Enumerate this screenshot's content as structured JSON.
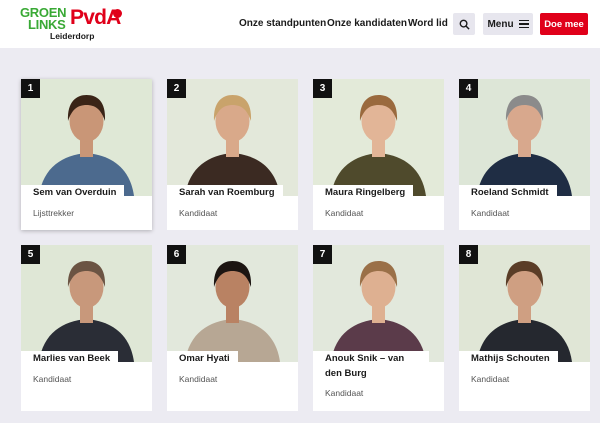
{
  "brand": {
    "line1": "GROEN",
    "line2": "LINKS",
    "party": "PvdA",
    "local": "Leiderdorp"
  },
  "nav": {
    "items": [
      "Onze standpunten",
      "Onze kandidaten",
      "Word lid"
    ],
    "menu_label": "Menu",
    "cta_label": "Doe mee"
  },
  "candidates": [
    {
      "number": "1",
      "name": "Sem van Overduin",
      "role": "Lijsttrekker",
      "bg": "#dfe8d6",
      "hair": "#3a2417",
      "skin": "#c99677",
      "clothes": "#4c6a8e"
    },
    {
      "number": "2",
      "name": "Sarah van Roemburg",
      "role": "Kandidaat",
      "bg": "#e3e8da",
      "hair": "#c9a36b",
      "skin": "#d9a98a",
      "clothes": "#3b2a22"
    },
    {
      "number": "3",
      "name": "Maura Ringelberg",
      "role": "Kandidaat",
      "bg": "#e3ead9",
      "hair": "#9a6a3e",
      "skin": "#e2b597",
      "clothes": "#4f4a2c"
    },
    {
      "number": "4",
      "name": "Roeland Schmidt",
      "role": "Kandidaat",
      "bg": "#dde6d7",
      "hair": "#8b8b8b",
      "skin": "#d8a88d",
      "clothes": "#1f2d44"
    },
    {
      "number": "5",
      "name": "Marlies van Beek",
      "role": "Kandidaat",
      "bg": "#dfe7d6",
      "hair": "#6b5443",
      "skin": "#c8987b",
      "clothes": "#2a2d36"
    },
    {
      "number": "6",
      "name": "Omar Hyati",
      "role": "Kandidaat",
      "bg": "#e2e8dc",
      "hair": "#1c1512",
      "skin": "#b98263",
      "clothes": "#b7a794"
    },
    {
      "number": "7",
      "name": "Anouk Snik – van den Burg",
      "role": "Kandidaat",
      "bg": "#e2e8dc",
      "hair": "#9a7048",
      "skin": "#deb091",
      "clothes": "#5b3b4a"
    },
    {
      "number": "8",
      "name": "Mathijs Schouten",
      "role": "Kandidaat",
      "bg": "#e0e6d6",
      "hair": "#5a3d27",
      "skin": "#cf9f82",
      "clothes": "#25282f"
    }
  ]
}
